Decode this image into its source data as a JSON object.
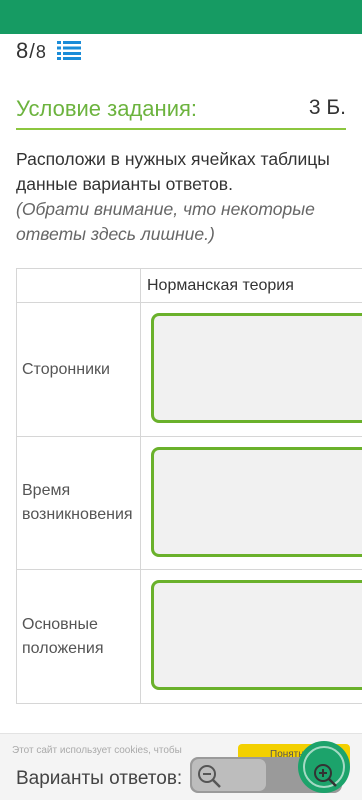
{
  "progress": {
    "current": "8",
    "separator": "/",
    "total": "8"
  },
  "condition": {
    "title": "Условие задания:",
    "points": "3 Б."
  },
  "task": {
    "text": "Расположи в нужных ячейках таблицы данные варианты ответов.",
    "note_open": "(",
    "note": "Обрати внимание, что некоторые ответы здесь лишние.",
    "note_close": ")"
  },
  "table": {
    "header": "Норманская теория",
    "rows": [
      {
        "label": "Сторонники"
      },
      {
        "label": "Время возникновения"
      },
      {
        "label": "Основные положения"
      }
    ]
  },
  "cookie_text": "Этот сайт использует cookies, чтобы",
  "cookie_button": "Понятно",
  "answers_title": "Варианты ответов:",
  "colors": {
    "topbar": "#169b63",
    "accent_green": "#6cb33e",
    "dropbox_border": "#6ab12b"
  }
}
